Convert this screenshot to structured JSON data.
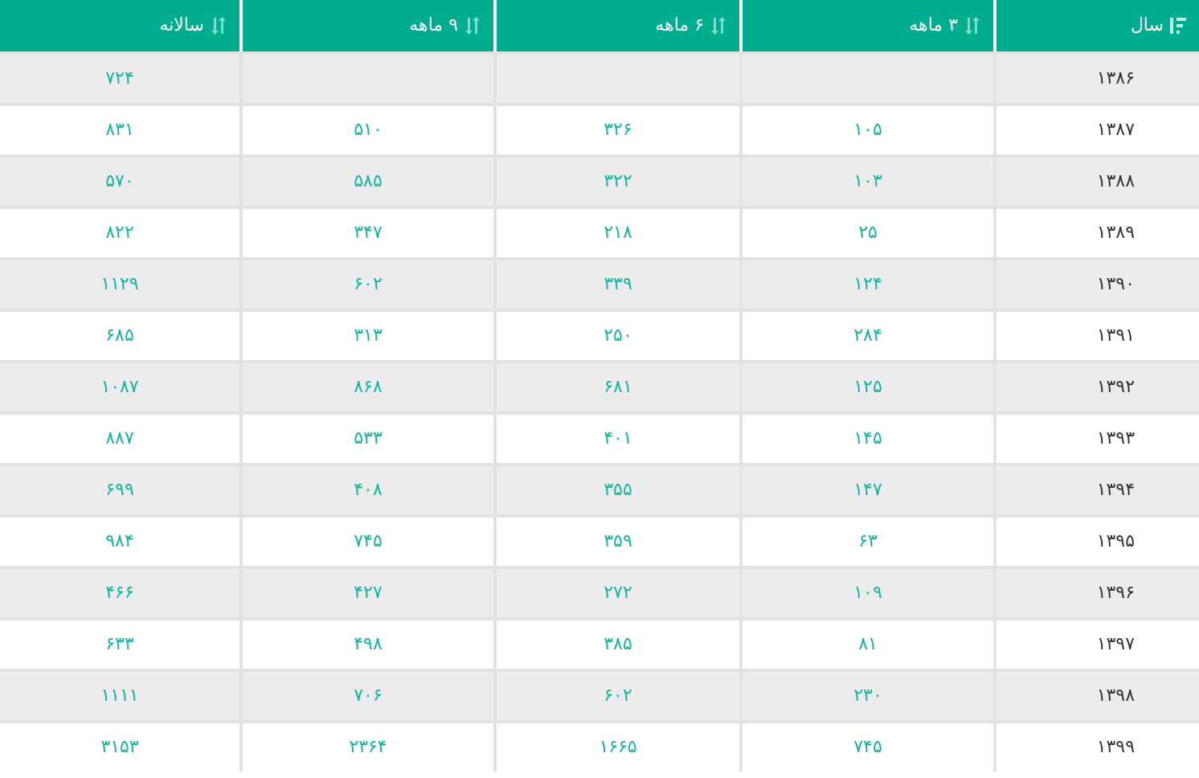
{
  "table": {
    "columns": [
      {
        "label": "سال",
        "sorted": true
      },
      {
        "label": "۳ ماهه",
        "sorted": false
      },
      {
        "label": "۶ ماهه",
        "sorted": false
      },
      {
        "label": "۹ ماهه",
        "sorted": false
      },
      {
        "label": "سالانه",
        "sorted": false
      }
    ],
    "rows": [
      {
        "cells": [
          "۱۳۸۶",
          null,
          null,
          null,
          "۷۲۴"
        ]
      },
      {
        "cells": [
          "۱۳۸۷",
          "۱۰۵",
          "۳۲۶",
          "۵۱۰",
          "۸۳۱"
        ]
      },
      {
        "cells": [
          "۱۳۸۸",
          "۱۰۳",
          "۳۲۲",
          "۵۸۵",
          "۵۷۰"
        ]
      },
      {
        "cells": [
          "۱۳۸۹",
          "۲۵",
          "۲۱۸",
          "۳۴۷",
          "۸۲۲"
        ]
      },
      {
        "cells": [
          "۱۳۹۰",
          "۱۲۴",
          "۳۳۹",
          "۶۰۲",
          "۱۱۲۹"
        ]
      },
      {
        "cells": [
          "۱۳۹۱",
          "۲۸۴",
          "۲۵۰",
          "۳۱۳",
          "۶۸۵"
        ]
      },
      {
        "cells": [
          "۱۳۹۲",
          "۱۲۵",
          "۶۸۱",
          "۸۶۸",
          "۱۰۸۷"
        ]
      },
      {
        "cells": [
          "۱۳۹۳",
          "۱۴۵",
          "۴۰۱",
          "۵۳۳",
          "۸۸۷"
        ]
      },
      {
        "cells": [
          "۱۳۹۴",
          "۱۴۷",
          "۳۵۵",
          "۴۰۸",
          "۶۹۹"
        ]
      },
      {
        "cells": [
          "۱۳۹۵",
          "۶۳",
          "۳۵۹",
          "۷۴۵",
          "۹۸۴"
        ]
      },
      {
        "cells": [
          "۱۳۹۶",
          "۱۰۹",
          "۲۷۲",
          "۴۲۷",
          "۴۶۶"
        ]
      },
      {
        "cells": [
          "۱۳۹۷",
          "۸۱",
          "۳۸۵",
          "۴۹۸",
          "۶۳۳"
        ]
      },
      {
        "cells": [
          "۱۳۹۸",
          "۲۳۰",
          "۶۰۲",
          "۷۰۶",
          "۱۱۱۱"
        ]
      },
      {
        "cells": [
          "۱۳۹۹",
          "۷۴۵",
          "۱۶۶۵",
          "۲۳۶۴",
          "۳۱۵۳"
        ]
      }
    ]
  }
}
